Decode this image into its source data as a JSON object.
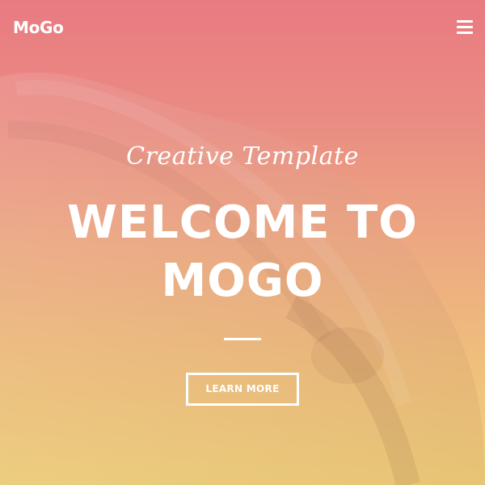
{
  "header": {
    "logo": "MoGo",
    "menu_icon": "hamburger-menu-icon"
  },
  "hero": {
    "subtitle": "Creative Template",
    "title_line1": "WELCOME TO",
    "title_line2": "MOGO",
    "button_label": "LEARN MORE",
    "background_image": "eagle-wings-photo"
  },
  "colors": {
    "gradient_top": "#e97a82",
    "gradient_bottom": "#f1d27c",
    "text": "#ffffff"
  }
}
